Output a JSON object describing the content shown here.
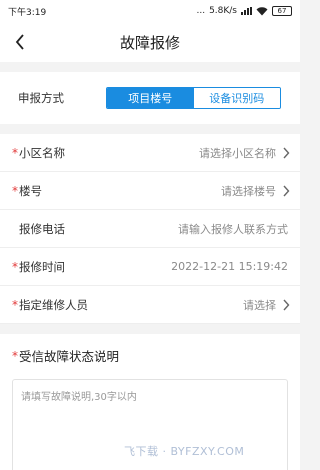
{
  "status": {
    "time": "下午3:19",
    "dots": "...",
    "speed": "5.8K/s",
    "battery": "67"
  },
  "header": {
    "title": "故障报修"
  },
  "method": {
    "label": "申报方式",
    "options": [
      "项目楼号",
      "设备识别码"
    ],
    "selected": "项目楼号"
  },
  "fields": [
    {
      "label": "小区名称",
      "value": "请选择小区名称",
      "required": true,
      "arrow": true
    },
    {
      "label": "楼号",
      "value": "请选择楼号",
      "required": true,
      "arrow": true
    },
    {
      "label": "报修电话",
      "value": "请输入报修人联系方式",
      "required": false,
      "arrow": false
    },
    {
      "label": "报修时间",
      "value": "2022-12-21 15:19:42",
      "required": true,
      "arrow": false
    },
    {
      "label": "指定维修人员",
      "value": "请选择",
      "required": true,
      "arrow": true
    }
  ],
  "description": {
    "title": "受信故障状态说明",
    "placeholder": "请填写故障说明,30字以内"
  },
  "required_mark": "*",
  "watermark": "飞下载 · BYFZXY.COM",
  "colors": {
    "accent": "#1a8ce0",
    "required": "#e23a3a"
  }
}
